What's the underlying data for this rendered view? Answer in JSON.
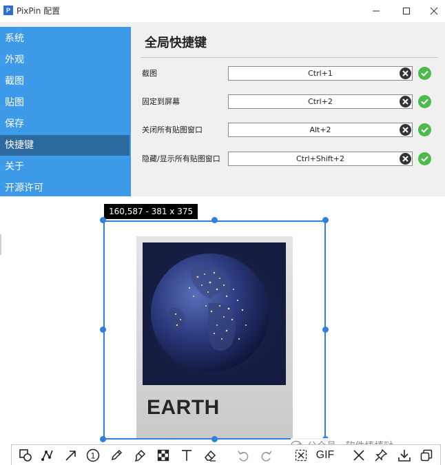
{
  "window": {
    "app_name": "PixPin",
    "title": "配置",
    "logo_text": "P",
    "controls": [
      "minimize",
      "maximize",
      "close"
    ]
  },
  "sidebar": {
    "items": [
      {
        "label": "系统"
      },
      {
        "label": "外观"
      },
      {
        "label": "截图"
      },
      {
        "label": "贴图"
      },
      {
        "label": "保存"
      },
      {
        "label": "快捷键",
        "active": true
      },
      {
        "label": "关于"
      },
      {
        "label": "开源许可"
      }
    ]
  },
  "hotkeys": {
    "title": "全局快捷键",
    "rows": [
      {
        "label": "截图",
        "value": "Ctrl+1"
      },
      {
        "label": "固定到屏幕",
        "value": "Ctrl+2"
      },
      {
        "label": "关闭所有贴图窗口",
        "value": "Alt+2"
      },
      {
        "label": "隐藏/显示所有贴图窗口",
        "value": "Ctrl+Shift+2"
      }
    ]
  },
  "capture": {
    "size_tip": "160,587 - 381 x 375",
    "poster_text": "EARTH"
  },
  "watermark": {
    "text": "公众号 · 软件棒棒哒"
  },
  "toolbar": {
    "tools": [
      "shape-tool",
      "polyline-tool",
      "arrow-tool",
      "number-marker-tool",
      "pencil-tool",
      "highlighter-tool",
      "mosaic-tool",
      "text-tool",
      "eraser-tool",
      "undo",
      "redo",
      "scroll-capture",
      "gif-record",
      "cancel",
      "pin",
      "save",
      "copy"
    ],
    "gif_label": "GIF"
  },
  "colors": {
    "sidebar_bg": "#3d9ae8",
    "sidebar_active": "#2d6aa0",
    "selection": "#2f7fe0",
    "ok_green": "#4cbb4a",
    "brand_blue": "#2b6fd6"
  }
}
